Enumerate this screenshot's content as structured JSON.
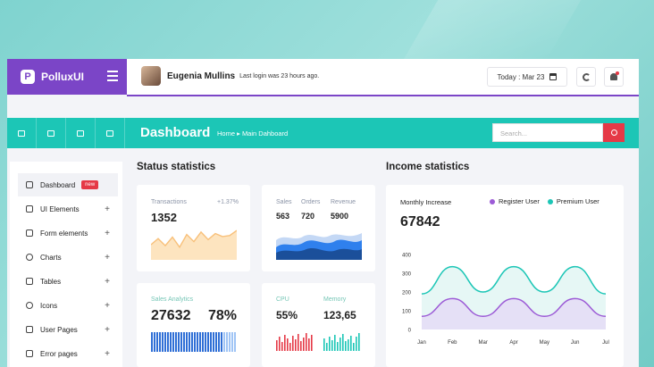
{
  "brand": {
    "name": "PolluxUI",
    "logo_letter": "P"
  },
  "header": {
    "user_name": "Eugenia Mullins",
    "last_login": "Last login was 23 hours ago.",
    "date_label": "Today : Mar 23"
  },
  "toolbar": {
    "page_title": "Dashboard",
    "breadcrumb": "Home ▸ Main Dahboard",
    "search_placeholder": "Search..."
  },
  "sidebar": {
    "items": [
      {
        "label": "Dashboard",
        "badge": "new"
      },
      {
        "label": "UI Elements",
        "plus": "+"
      },
      {
        "label": "Form elements",
        "plus": "+"
      },
      {
        "label": "Charts",
        "plus": "+"
      },
      {
        "label": "Tables",
        "plus": "+"
      },
      {
        "label": "Icons",
        "plus": "+"
      },
      {
        "label": "User Pages",
        "plus": "+"
      },
      {
        "label": "Error pages",
        "plus": "+"
      }
    ]
  },
  "status": {
    "title": "Status statistics",
    "transactions": {
      "label": "Transactions",
      "change": "+1.37%",
      "value": "1352",
      "spark": [
        30,
        42,
        28,
        45,
        25,
        50,
        36,
        55,
        40,
        52,
        46,
        48,
        58
      ]
    },
    "sales": {
      "labels": [
        "Sales",
        "Orders",
        "Revenue"
      ],
      "values": [
        "563",
        "720",
        "5900"
      ]
    },
    "analytics": {
      "label": "Sales Analytics",
      "value": "27632",
      "percent": "78%"
    },
    "cpu": {
      "label": "CPU",
      "value": "55%"
    },
    "memory": {
      "label": "Memory",
      "value": "123,65"
    },
    "colors": {
      "orange": "#f8c07a",
      "blue_dark": "#1b4f9a",
      "blue_mid": "#2f80ed",
      "blue_light": "#c4d8f5",
      "red": "#e53946",
      "teal": "#1cc6b6"
    }
  },
  "income": {
    "title": "Income statistics",
    "subtitle": "Monthly Increase",
    "value": "67842",
    "legend": [
      {
        "name": "Register User",
        "color": "#9c5bd6"
      },
      {
        "name": "Premium User",
        "color": "#1cc6b6"
      }
    ]
  },
  "chart_data": {
    "type": "line",
    "x": [
      "Jan",
      "Feb",
      "Mar",
      "Apr",
      "May",
      "Jun",
      "Jul"
    ],
    "yticks": [
      0,
      100,
      200,
      300,
      400
    ],
    "ylim": [
      0,
      400
    ],
    "series": [
      {
        "name": "Premium User",
        "values": [
          190,
          335,
          200,
          335,
          200,
          335,
          190
        ]
      },
      {
        "name": "Register User",
        "values": [
          70,
          165,
          70,
          165,
          70,
          165,
          70
        ]
      }
    ]
  }
}
